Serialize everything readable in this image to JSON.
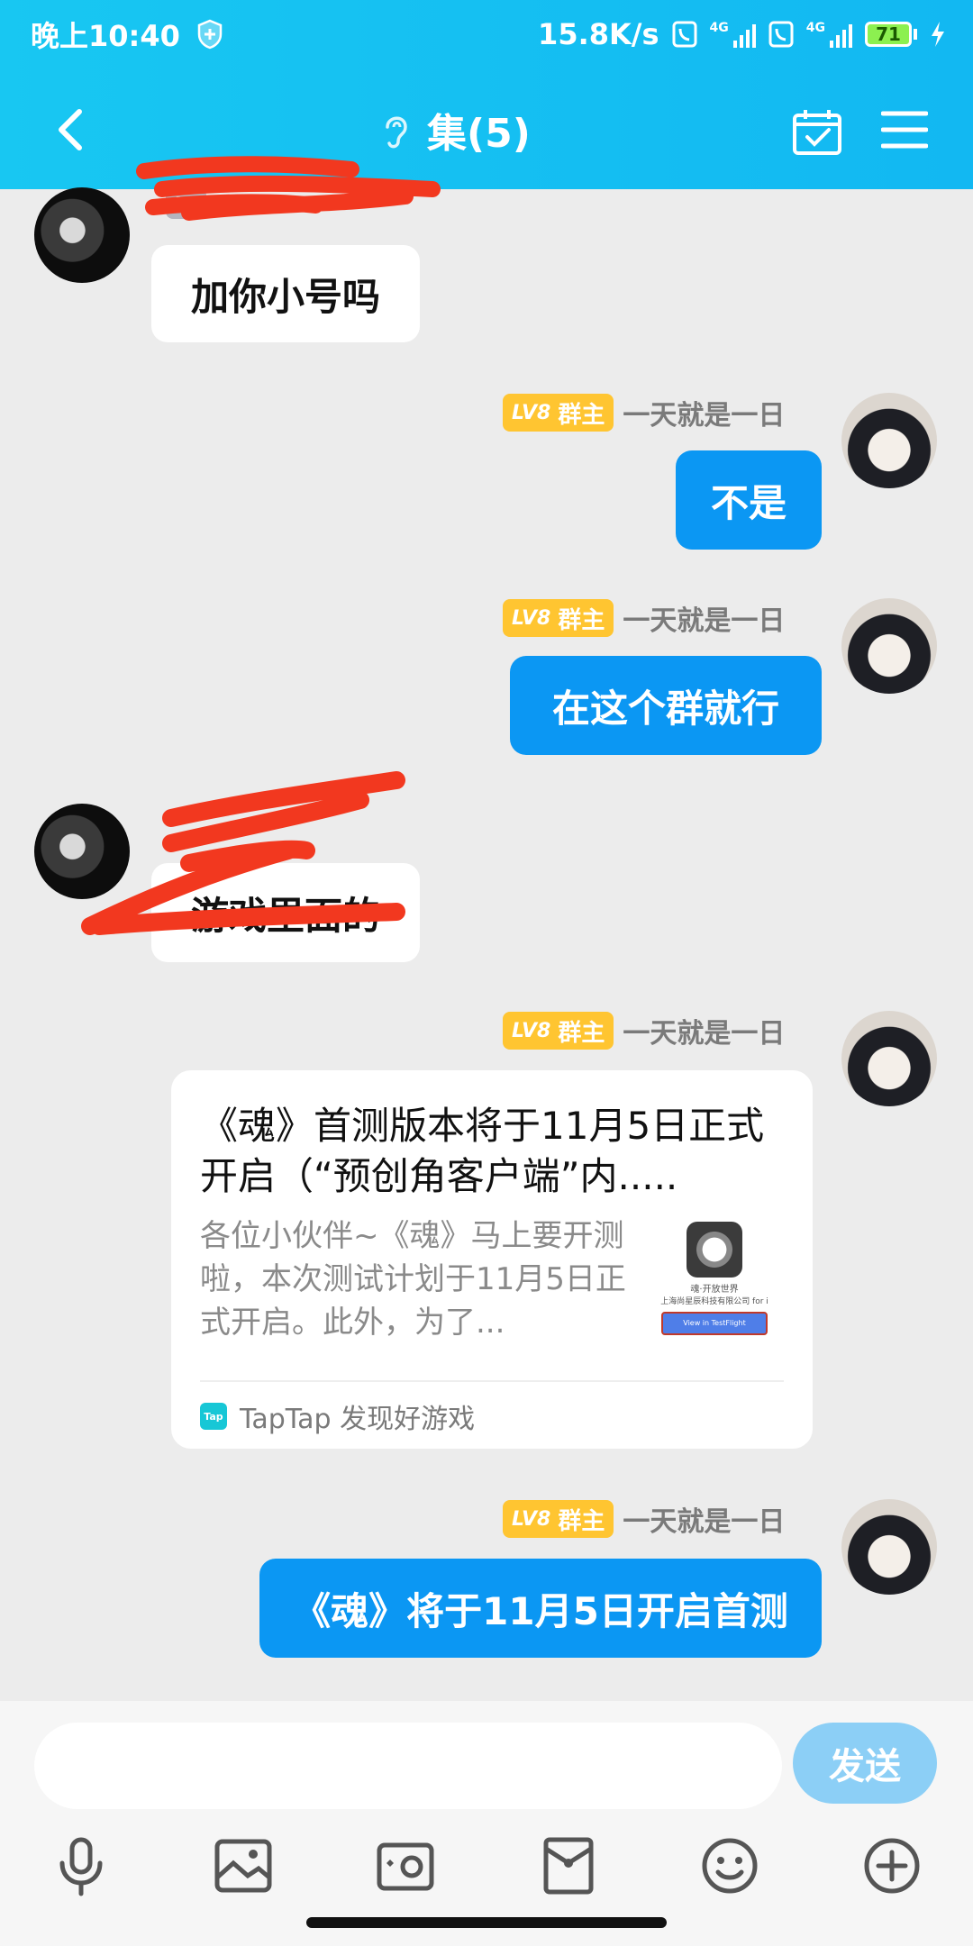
{
  "status_bar": {
    "time": "晚上10:40",
    "speed": "15.8K/s",
    "net1": "4G",
    "net2": "4G",
    "battery": "71"
  },
  "header": {
    "title": "集(5)"
  },
  "messages": [
    {
      "type": "incoming",
      "name_badge": "LV",
      "text": "加你小号吗"
    },
    {
      "type": "outgoing",
      "level": "LV8",
      "role": "群主",
      "nickname": "一天就是一日",
      "text": "不是"
    },
    {
      "type": "outgoing",
      "level": "LV8",
      "role": "群主",
      "nickname": "一天就是一日",
      "text": "在这个群就行"
    },
    {
      "type": "incoming",
      "text": "游戏里面的"
    },
    {
      "type": "outgoing",
      "level": "LV8",
      "role": "群主",
      "nickname": "一天就是一日",
      "card": {
        "title": "《魂》首测版本将于11月5日正式开启（“预创角客户端”内.....",
        "description": "各位小伙伴~《魂》马上要开测啦，本次测试计划于11月5日正式开启。此外，为了...",
        "thumb_text1": "魂·开放世界",
        "thumb_text2": "上海尚星辰科技有限公司 for i",
        "thumb_button": "View in TestFlight",
        "source_icon": "Tap",
        "source": "TapTap 发现好游戏"
      }
    },
    {
      "type": "outgoing",
      "level": "LV8",
      "role": "群主",
      "nickname": "一天就是一日",
      "text": "《魂》将于11月5日开启首测"
    }
  ],
  "composer": {
    "placeholder": "",
    "send_label": "发送"
  },
  "colors": {
    "header": "#14bff2",
    "outgoing_bubble": "#0b97f3",
    "badge": "#ffc531",
    "redaction": "#f2381f"
  }
}
